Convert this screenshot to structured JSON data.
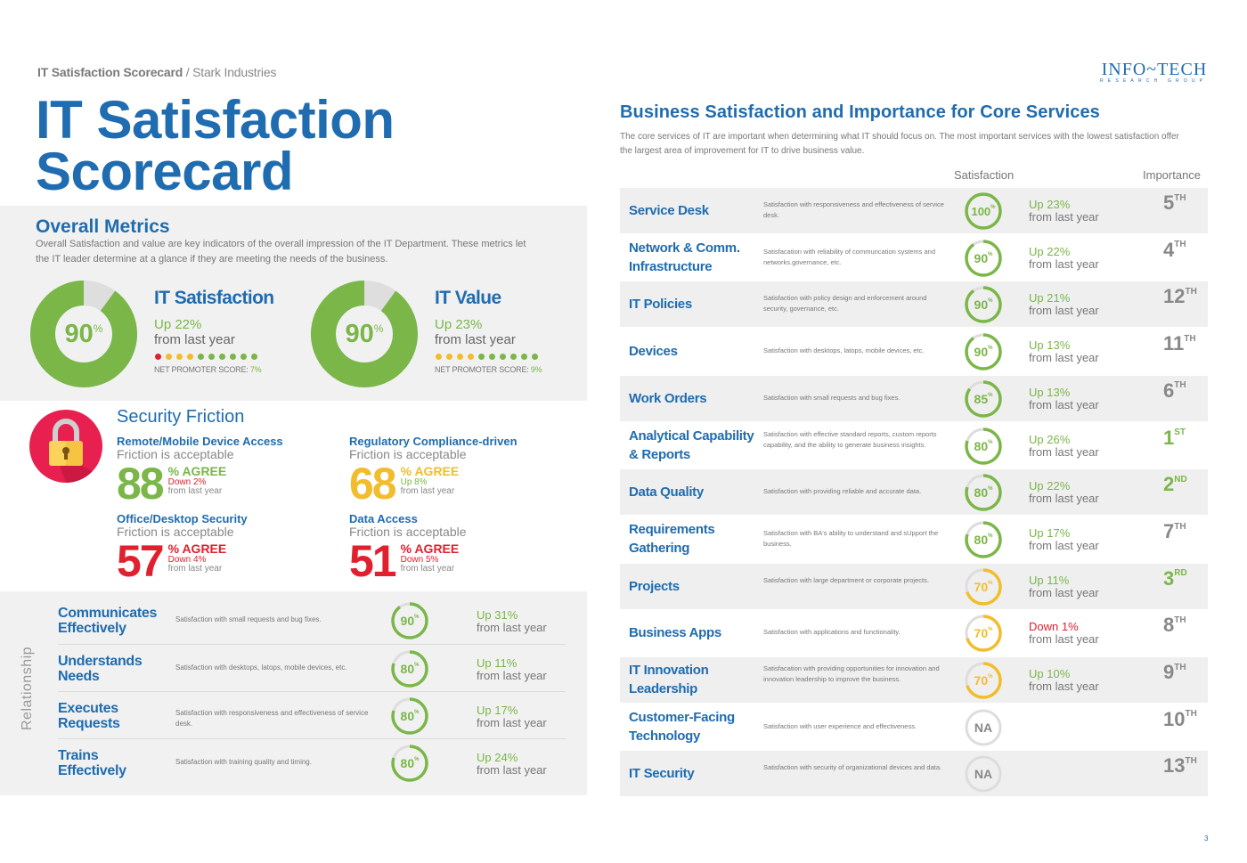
{
  "breadcrumb": {
    "doc": "IT Satisfaction Scorecard",
    "separator": " / ",
    "company": "Stark Industries"
  },
  "title": {
    "line1": "IT Satisfaction",
    "line2": "Scorecard"
  },
  "overall": {
    "heading": "Overall Metrics",
    "description": "Overall Satisfaction and value are key indicators of the overall impression of the IT Department. These metrics let the IT leader determine at a glance if they are meeting the needs of the business.",
    "metrics": [
      {
        "title": "IT Satisfaction",
        "value": "90",
        "unit": "%",
        "percent": 90,
        "change": "Up 22%",
        "change_sub": "from last year",
        "nps_label": "NET PROMOTER SCORE: ",
        "nps_value": "7%",
        "nps_dots": [
          "red",
          "yellow",
          "yellow",
          "yellow",
          "green",
          "green",
          "green",
          "green",
          "green",
          "green"
        ]
      },
      {
        "title": "IT Value",
        "value": "90",
        "unit": "%",
        "percent": 90,
        "change": "Up 23%",
        "change_sub": "from last year",
        "nps_label": "NET PROMOTER SCORE: ",
        "nps_value": "9%",
        "nps_dots": [
          "yellow",
          "yellow",
          "yellow",
          "yellow",
          "green",
          "green",
          "green",
          "green",
          "green",
          "green"
        ]
      }
    ]
  },
  "security": {
    "heading": "Security Friction",
    "icon": "lock-icon",
    "items": [
      {
        "name": "Remote/Mobile Device Access",
        "friction": "Friction is acceptable",
        "value": "88",
        "agree": "% AGREE",
        "change": "Down 2%",
        "change_sub": "from last year",
        "color": "green",
        "change_color": "red"
      },
      {
        "name": "Regulatory Compliance-driven",
        "friction": "Friction is acceptable",
        "value": "68",
        "agree": "% AGREE",
        "change": "Up 8%",
        "change_sub": "from last year",
        "color": "yellow",
        "change_color": "green"
      },
      {
        "name": "Office/Desktop Security",
        "friction": "Friction is acceptable",
        "value": "57",
        "agree": "% AGREE",
        "change": "Down 4%",
        "change_sub": "from last year",
        "color": "red",
        "change_color": "red"
      },
      {
        "name": "Data Access",
        "friction": "Friction is acceptable",
        "value": "51",
        "agree": "% AGREE",
        "change": "Down 5%",
        "change_sub": "from last year",
        "color": "red",
        "change_color": "red"
      }
    ]
  },
  "relationship": {
    "side_label": "Relationship",
    "rows": [
      {
        "name1": "Communicates",
        "name2": "Effectively",
        "desc": "Satisfaction with small requests and bug fixes.",
        "value": "90",
        "percent": 90,
        "change": "Up 31%",
        "change_sub": "from last year"
      },
      {
        "name1": "Understands",
        "name2": "Needs",
        "desc": "Satisfaction with desktops, latops, mobile devices, etc.",
        "value": "80",
        "percent": 80,
        "change": "Up 11%",
        "change_sub": "from last year"
      },
      {
        "name1": "Executes",
        "name2": "Requests",
        "desc": "Satisfaction with responsiveness and effectiveness of service desk.",
        "value": "80",
        "percent": 80,
        "change": "Up 17%",
        "change_sub": "from last year"
      },
      {
        "name1": "Trains",
        "name2": "Effectively",
        "desc": "Satisfaction with training quality and timing.",
        "value": "80",
        "percent": 80,
        "change": "Up 24%",
        "change_sub": "from last year"
      }
    ]
  },
  "logo": {
    "line1": "INFO~TECH",
    "line2": "RESEARCH GROUP"
  },
  "core": {
    "heading": "Business Satisfaction and Importance for Core Services",
    "description": "The core services of IT are important when determining what IT should focus on. The most important services with the lowest satisfaction offer the largest area of improvement for IT to drive business value.",
    "col_satisfaction": "Satisfaction",
    "col_importance": "Importance",
    "rows": [
      {
        "name": "Service Desk",
        "desc": "Satisfaction with responsiveness and effectiveness of service desk.",
        "value": "100",
        "percent": 100,
        "color": "green",
        "change": "Up 23%",
        "change_color": "green",
        "change_sub": "from last year",
        "rank": "5",
        "rank_suffix": "TH",
        "rank_top": false
      },
      {
        "name": "Network & Comm. Infrastructure",
        "desc": "Satisfacation with reliability of communcation systems and networks.governance, etc.",
        "value": "90",
        "percent": 90,
        "color": "green",
        "change": "Up 22%",
        "change_color": "green",
        "change_sub": "from last year",
        "rank": "4",
        "rank_suffix": "TH",
        "rank_top": false
      },
      {
        "name": "IT Policies",
        "desc": "Satisfaction with policy design and enforcement around security, governance, etc.",
        "value": "90",
        "percent": 90,
        "color": "green",
        "change": "Up 21%",
        "change_color": "green",
        "change_sub": "from last year",
        "rank": "12",
        "rank_suffix": "TH",
        "rank_top": false
      },
      {
        "name": "Devices",
        "desc": "Satisfaction with desktops, latops, mobile devices, etc.",
        "value": "90",
        "percent": 90,
        "color": "green",
        "change": "Up 13%",
        "change_color": "green",
        "change_sub": "from last year",
        "rank": "11",
        "rank_suffix": "TH",
        "rank_top": false
      },
      {
        "name": "Work Orders",
        "desc": "Satisfaction with small requests and bug fixes.",
        "value": "85",
        "percent": 85,
        "color": "green",
        "change": "Up 13%",
        "change_color": "green",
        "change_sub": "from last year",
        "rank": "6",
        "rank_suffix": "TH",
        "rank_top": false
      },
      {
        "name": "Analytical Capability & Reports",
        "desc": "Satisfaction with effective standard reports, custom reports capability, and the ability to generate business insights.",
        "value": "80",
        "percent": 80,
        "color": "green",
        "change": "Up 26%",
        "change_color": "green",
        "change_sub": "from last year",
        "rank": "1",
        "rank_suffix": "ST",
        "rank_top": true
      },
      {
        "name": "Data Quality",
        "desc": "Satisfaction with providing reliable and accurate data.",
        "value": "80",
        "percent": 80,
        "color": "green",
        "change": "Up 22%",
        "change_color": "green",
        "change_sub": "from last year",
        "rank": "2",
        "rank_suffix": "ND",
        "rank_top": true
      },
      {
        "name": "Requirements Gathering",
        "desc": "Satisfaction with BA's ability to understand and sUpport the business.",
        "value": "80",
        "percent": 80,
        "color": "green",
        "change": "Up 17%",
        "change_color": "green",
        "change_sub": "from last year",
        "rank": "7",
        "rank_suffix": "TH",
        "rank_top": false
      },
      {
        "name": "Projects",
        "desc": "Satisfaction with large department or corporate projects.",
        "value": "70",
        "percent": 70,
        "color": "yellow",
        "change": "Up 11%",
        "change_color": "green",
        "change_sub": "from last year",
        "rank": "3",
        "rank_suffix": "RD",
        "rank_top": true
      },
      {
        "name": "Business Apps",
        "desc": "Satisfaction with applications and functionality.",
        "value": "70",
        "percent": 70,
        "color": "yellow",
        "change": "Down 1%",
        "change_color": "red",
        "change_sub": "from last year",
        "rank": "8",
        "rank_suffix": "TH",
        "rank_top": false
      },
      {
        "name": "IT Innovation Leadership",
        "desc": "Satisfacation with providing opportunities for innovation and innovation leadership to improve the business.",
        "value": "70",
        "percent": 70,
        "color": "yellow",
        "change": "Up 10%",
        "change_color": "green",
        "change_sub": "from last year",
        "rank": "9",
        "rank_suffix": "TH",
        "rank_top": false
      },
      {
        "name": "Customer-Facing Technology",
        "desc": "Satisfaction with user experience and effectiveness.",
        "value": "NA",
        "percent": 0,
        "color": "gray",
        "change": "",
        "change_color": "green",
        "change_sub": "",
        "rank": "10",
        "rank_suffix": "TH",
        "rank_top": false
      },
      {
        "name": "IT Security",
        "desc": "Satisfaction with security of organizational devices and data.",
        "value": "NA",
        "percent": 0,
        "color": "gray",
        "change": "",
        "change_color": "green",
        "change_sub": "",
        "rank": "13",
        "rank_suffix": "TH",
        "rank_top": false
      }
    ]
  },
  "colors": {
    "blue": "#1f6cb0",
    "green": "#7ab648",
    "yellow": "#f2bd2c",
    "red": "#e0202e",
    "gray": "#888888"
  },
  "page_number": "3"
}
